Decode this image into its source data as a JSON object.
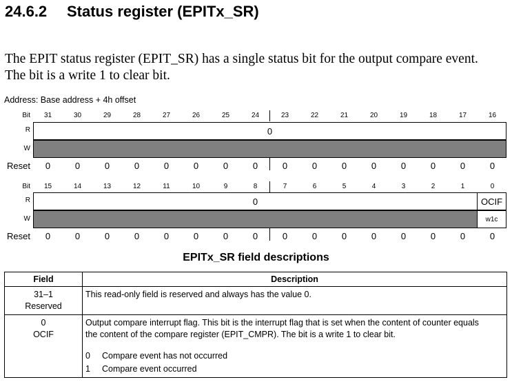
{
  "section": {
    "number": "24.6.2",
    "title": "Status register (EPITx_SR)"
  },
  "intro": {
    "line1": "The EPIT status register (EPIT_SR) has a single status bit for the output compare event.",
    "line2": "The bit is a write 1 to clear bit."
  },
  "address": "Address: Base address + 4h offset",
  "labels": {
    "bit": "Bit",
    "r": "R",
    "w": "W",
    "reset": "Reset"
  },
  "upper": {
    "bits": [
      "31",
      "30",
      "29",
      "28",
      "27",
      "26",
      "25",
      "24",
      "23",
      "22",
      "21",
      "20",
      "19",
      "18",
      "17",
      "16"
    ],
    "r_value": "0",
    "reset": [
      "0",
      "0",
      "0",
      "0",
      "0",
      "0",
      "0",
      "0",
      "0",
      "0",
      "0",
      "0",
      "0",
      "0",
      "0",
      "0"
    ]
  },
  "lower": {
    "bits": [
      "15",
      "14",
      "13",
      "12",
      "11",
      "10",
      "9",
      "8",
      "7",
      "6",
      "5",
      "4",
      "3",
      "2",
      "1",
      "0"
    ],
    "r_value": "0",
    "ocif_r": "OCIF",
    "ocif_w": "w1c",
    "reset": [
      "0",
      "0",
      "0",
      "0",
      "0",
      "0",
      "0",
      "0",
      "0",
      "0",
      "0",
      "0",
      "0",
      "0",
      "0",
      "0"
    ]
  },
  "table": {
    "title": "EPITx_SR field descriptions",
    "headers": {
      "field": "Field",
      "description": "Description"
    },
    "rows": [
      {
        "field_bits": "31–1",
        "field_name": "Reserved",
        "desc1": "This read-only field is reserved and always has the value 0."
      },
      {
        "field_bits": "0",
        "field_name": "OCIF",
        "desc1": "Output compare interrupt flag. This bit is the interrupt flag that is set when the content of counter equals",
        "desc2": "the content of the compare register (EPIT_CMPR). The bit is a write 1 to clear bit.",
        "values": [
          {
            "v": "0",
            "text": "Compare event has not occurred"
          },
          {
            "v": "1",
            "text": "Compare event occurred"
          }
        ]
      }
    ]
  }
}
